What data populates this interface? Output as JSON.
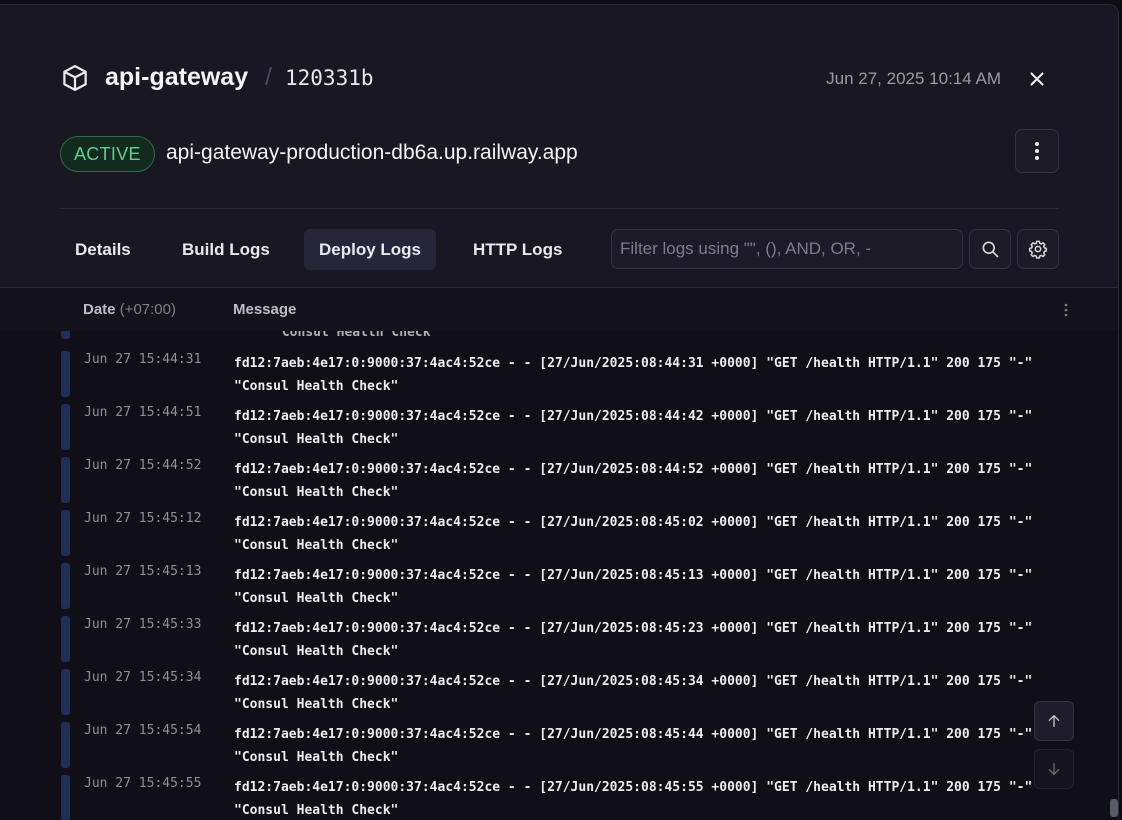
{
  "header": {
    "service_name": "api-gateway",
    "separator": "/",
    "commit": "120331b",
    "timestamp": "Jun 27, 2025 10:14 AM",
    "icon": "cube-icon"
  },
  "status": {
    "badge": "ACTIVE",
    "badge_color": "#5fcf8b",
    "domain": "api-gateway-production-db6a.up.railway.app"
  },
  "tabs": [
    {
      "label": "Details",
      "active": false
    },
    {
      "label": "Build Logs",
      "active": false
    },
    {
      "label": "Deploy Logs",
      "active": true
    },
    {
      "label": "HTTP Logs",
      "active": false
    }
  ],
  "filter": {
    "placeholder": "Filter logs using \"\", (), AND, OR, -",
    "value": ""
  },
  "log_table": {
    "col_date": "Date",
    "col_date_tz": "(+07:00)",
    "col_message": "Message",
    "partial_line": "\"Consul Health Check\"",
    "rows": [
      {
        "date": "Jun 27 15:44:31",
        "message": "fd12:7aeb:4e17:0:9000:37:4ac4:52ce - - [27/Jun/2025:08:44:31 +0000] \"GET /health HTTP/1.1\" 200 175 \"-\" \"Consul Health Check\""
      },
      {
        "date": "Jun 27 15:44:51",
        "message": "fd12:7aeb:4e17:0:9000:37:4ac4:52ce - - [27/Jun/2025:08:44:42 +0000] \"GET /health HTTP/1.1\" 200 175 \"-\" \"Consul Health Check\""
      },
      {
        "date": "Jun 27 15:44:52",
        "message": "fd12:7aeb:4e17:0:9000:37:4ac4:52ce - - [27/Jun/2025:08:44:52 +0000] \"GET /health HTTP/1.1\" 200 175 \"-\" \"Consul Health Check\""
      },
      {
        "date": "Jun 27 15:45:12",
        "message": "fd12:7aeb:4e17:0:9000:37:4ac4:52ce - - [27/Jun/2025:08:45:02 +0000] \"GET /health HTTP/1.1\" 200 175 \"-\" \"Consul Health Check\""
      },
      {
        "date": "Jun 27 15:45:13",
        "message": "fd12:7aeb:4e17:0:9000:37:4ac4:52ce - - [27/Jun/2025:08:45:13 +0000] \"GET /health HTTP/1.1\" 200 175 \"-\" \"Consul Health Check\""
      },
      {
        "date": "Jun 27 15:45:33",
        "message": "fd12:7aeb:4e17:0:9000:37:4ac4:52ce - - [27/Jun/2025:08:45:23 +0000] \"GET /health HTTP/1.1\" 200 175 \"-\" \"Consul Health Check\""
      },
      {
        "date": "Jun 27 15:45:34",
        "message": "fd12:7aeb:4e17:0:9000:37:4ac4:52ce - - [27/Jun/2025:08:45:34 +0000] \"GET /health HTTP/1.1\" 200 175 \"-\" \"Consul Health Check\""
      },
      {
        "date": "Jun 27 15:45:54",
        "message": "fd12:7aeb:4e17:0:9000:37:4ac4:52ce - - [27/Jun/2025:08:45:44 +0000] \"GET /health HTTP/1.1\" 200 175 \"-\" \"Consul Health Check\""
      },
      {
        "date": "Jun 27 15:45:55",
        "message": "fd12:7aeb:4e17:0:9000:37:4ac4:52ce - - [27/Jun/2025:08:45:55 +0000] \"GET /health HTTP/1.1\" 200 175 \"-\" \"Consul Health Check\""
      }
    ]
  },
  "icons": {
    "close": "close-icon",
    "more": "more-vertical-icon",
    "search": "search-icon",
    "settings": "gear-icon",
    "scroll_up": "arrow-up-icon",
    "scroll_down": "arrow-down-icon"
  }
}
